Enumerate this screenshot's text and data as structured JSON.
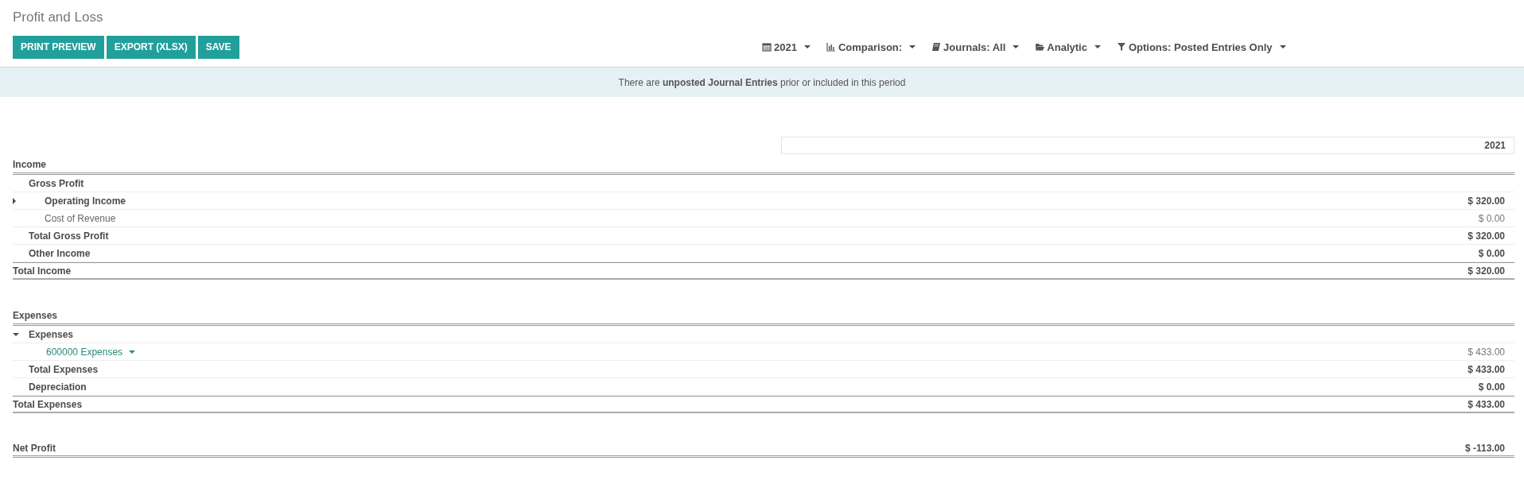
{
  "title": "Profit and Loss",
  "buttons": [
    "PRINT PREVIEW",
    "EXPORT (XLSX)",
    "SAVE"
  ],
  "filters": [
    {
      "kind": "calendar",
      "label": "2021"
    },
    {
      "kind": "chart",
      "label": "Comparison:"
    },
    {
      "kind": "book",
      "label": "Journals: All"
    },
    {
      "kind": "folder",
      "label": "Analytic"
    },
    {
      "kind": "filter",
      "label": "Options: Posted Entries Only"
    }
  ],
  "banner": "There are **unposted Journal Entries** prior or included in this period",
  "column_header": "2021",
  "sections": [
    {
      "title": "Income",
      "lines": [
        {
          "label": "Gross Profit",
          "kind": "group",
          "children": [
            {
              "label": "Operating Income",
              "kind": "group",
              "amount": "$ 320.00",
              "expanded": false
            },
            {
              "label": "Cost of Revenue",
              "kind": "account",
              "amount": "$ 0.00"
            }
          ]
        },
        {
          "label": "Total Gross Profit",
          "kind": "group",
          "amount": "$ 320.00"
        },
        {
          "label": "Other Income",
          "kind": "group",
          "amount": "$ 0.00"
        }
      ],
      "total": {
        "label": "Total Income",
        "amount": "$ 320.00"
      }
    },
    {
      "title": "Expenses",
      "lines": [
        {
          "label": "Expenses",
          "kind": "group",
          "expanded": true,
          "children": [
            {
              "label": "600000 Expenses",
              "kind": "link",
              "amount": "$ 433.00"
            }
          ]
        },
        {
          "label": "Total Expenses",
          "kind": "group",
          "amount": "$ 433.00"
        },
        {
          "label": "Depreciation",
          "kind": "group",
          "amount": "$ 0.00"
        }
      ],
      "total": {
        "label": "Total Expenses",
        "amount": "$ 433.00"
      }
    }
  ],
  "net_profit": {
    "label": "Net Profit",
    "amount": "$ -113.00"
  }
}
